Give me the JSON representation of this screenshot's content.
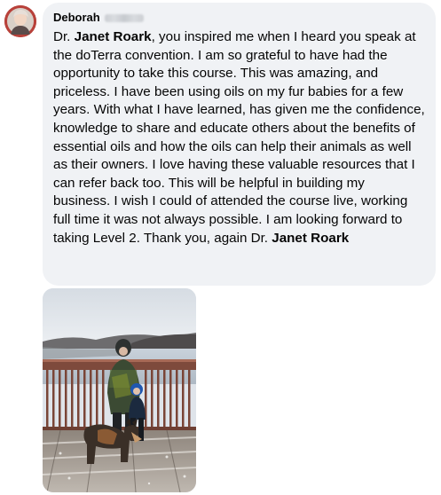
{
  "comment": {
    "author": {
      "first_name": "Deborah",
      "last_name_obscured": true
    },
    "text_segments": [
      "Dr. ",
      "Janet Roark",
      ", you inspired me when I heard you speak at the doTerra convention. I am so grateful to have had the opportunity to take this course. This was amazing, and priceless. I have been using oils on my fur babies for a few years. With what I have learned, has given me the confidence, knowledge to share and educate others about the benefits of essential oils and how the oils can help their animals as well as their owners. I love having these valuable resources that I can refer back too. This will be helpful in building my business. I wish I could of attended the course live, working full time it was not always possible. I am looking forward to taking Level 2. Thank you, again Dr. ",
      "Janet Roark"
    ]
  },
  "colors": {
    "bubble_background": "#f0f2f5",
    "text": "#050505",
    "avatar_frame": "#b8413a"
  },
  "icons": {
    "avatar": "profile-photo",
    "attachment": "photo-person-child-dog-on-bridge"
  }
}
